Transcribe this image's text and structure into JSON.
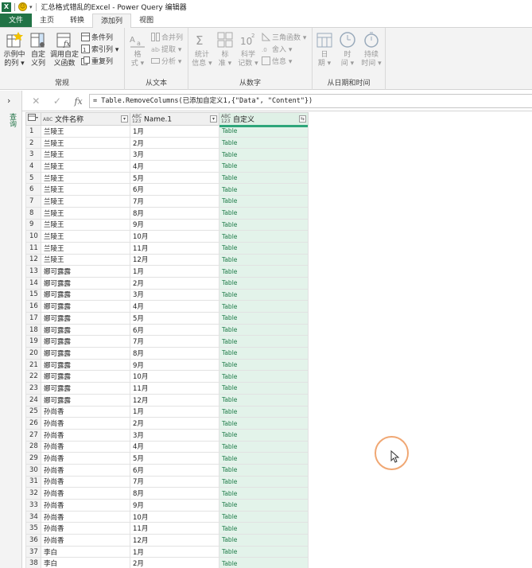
{
  "titlebar": {
    "app_badge": "X",
    "title": "汇总格式错乱的Excel - Power Query 编辑器"
  },
  "menu_tabs": [
    "文件",
    "主页",
    "转换",
    "添加列",
    "视图"
  ],
  "ribbon": {
    "groups": {
      "general": "常规",
      "from_text": "从文本",
      "from_number": "从数字",
      "from_datetime": "从日期和时间"
    },
    "buttons": {
      "example_col": [
        "示例中",
        "的列 ▾"
      ],
      "custom_col": [
        "自定",
        "义列"
      ],
      "invoke_custom_fn": [
        "调用自定",
        "义函数"
      ],
      "cond_col": "条件列",
      "index_col": "索引列 ▾",
      "dup_col": "重复列",
      "format": [
        "格",
        "式 ▾"
      ],
      "merge_cols": "合并列",
      "extract": "提取 ▾",
      "parse": "分析 ▾",
      "statistics": [
        "统计",
        "信息 ▾"
      ],
      "standard": [
        "标",
        "准 ▾"
      ],
      "scientific": [
        "科学",
        "记数 ▾"
      ],
      "trig": "三角函数 ▾",
      "rounding": "舍入 ▾",
      "information": "信息 ▾",
      "date": [
        "日",
        "期 ▾"
      ],
      "time": [
        "时",
        "间 ▾"
      ],
      "duration": [
        "持续",
        "时间 ▾"
      ]
    }
  },
  "left_pane": {
    "expand": "›",
    "label": "查询"
  },
  "formula_bar": {
    "cancel": "✕",
    "confirm": "✓",
    "fx": "fx",
    "formula": "= Table.RemoveColumns(已添加自定义1,{\"Data\", \"Content\"})"
  },
  "grid": {
    "columns": [
      {
        "type": "ABC",
        "name": "文件名称"
      },
      {
        "type": "ABC 123",
        "name": "Name.1"
      },
      {
        "type": "ABC 123",
        "name": "自定义"
      }
    ],
    "rows": [
      [
        "1",
        "兰陵王",
        "1月",
        "Table"
      ],
      [
        "2",
        "兰陵王",
        "2月",
        "Table"
      ],
      [
        "3",
        "兰陵王",
        "3月",
        "Table"
      ],
      [
        "4",
        "兰陵王",
        "4月",
        "Table"
      ],
      [
        "5",
        "兰陵王",
        "5月",
        "Table"
      ],
      [
        "6",
        "兰陵王",
        "6月",
        "Table"
      ],
      [
        "7",
        "兰陵王",
        "7月",
        "Table"
      ],
      [
        "8",
        "兰陵王",
        "8月",
        "Table"
      ],
      [
        "9",
        "兰陵王",
        "9月",
        "Table"
      ],
      [
        "10",
        "兰陵王",
        "10月",
        "Table"
      ],
      [
        "11",
        "兰陵王",
        "11月",
        "Table"
      ],
      [
        "12",
        "兰陵王",
        "12月",
        "Table"
      ],
      [
        "13",
        "娜可露露",
        "1月",
        "Table"
      ],
      [
        "14",
        "娜可露露",
        "2月",
        "Table"
      ],
      [
        "15",
        "娜可露露",
        "3月",
        "Table"
      ],
      [
        "16",
        "娜可露露",
        "4月",
        "Table"
      ],
      [
        "17",
        "娜可露露",
        "5月",
        "Table"
      ],
      [
        "18",
        "娜可露露",
        "6月",
        "Table"
      ],
      [
        "19",
        "娜可露露",
        "7月",
        "Table"
      ],
      [
        "20",
        "娜可露露",
        "8月",
        "Table"
      ],
      [
        "21",
        "娜可露露",
        "9月",
        "Table"
      ],
      [
        "22",
        "娜可露露",
        "10月",
        "Table"
      ],
      [
        "23",
        "娜可露露",
        "11月",
        "Table"
      ],
      [
        "24",
        "娜可露露",
        "12月",
        "Table"
      ],
      [
        "25",
        "孙尚香",
        "1月",
        "Table"
      ],
      [
        "26",
        "孙尚香",
        "2月",
        "Table"
      ],
      [
        "27",
        "孙尚香",
        "3月",
        "Table"
      ],
      [
        "28",
        "孙尚香",
        "4月",
        "Table"
      ],
      [
        "29",
        "孙尚香",
        "5月",
        "Table"
      ],
      [
        "30",
        "孙尚香",
        "6月",
        "Table"
      ],
      [
        "31",
        "孙尚香",
        "7月",
        "Table"
      ],
      [
        "32",
        "孙尚香",
        "8月",
        "Table"
      ],
      [
        "33",
        "孙尚香",
        "9月",
        "Table"
      ],
      [
        "34",
        "孙尚香",
        "10月",
        "Table"
      ],
      [
        "35",
        "孙尚香",
        "11月",
        "Table"
      ],
      [
        "36",
        "孙尚香",
        "12月",
        "Table"
      ],
      [
        "37",
        "李白",
        "1月",
        "Table"
      ],
      [
        "38",
        "李白",
        "2月",
        "Table"
      ]
    ]
  },
  "colors": {
    "file_tab": "#217346",
    "selected_column": "#e3f3ea",
    "column_accent": "#2ea67a",
    "cursor_ring": "#f0a773"
  }
}
